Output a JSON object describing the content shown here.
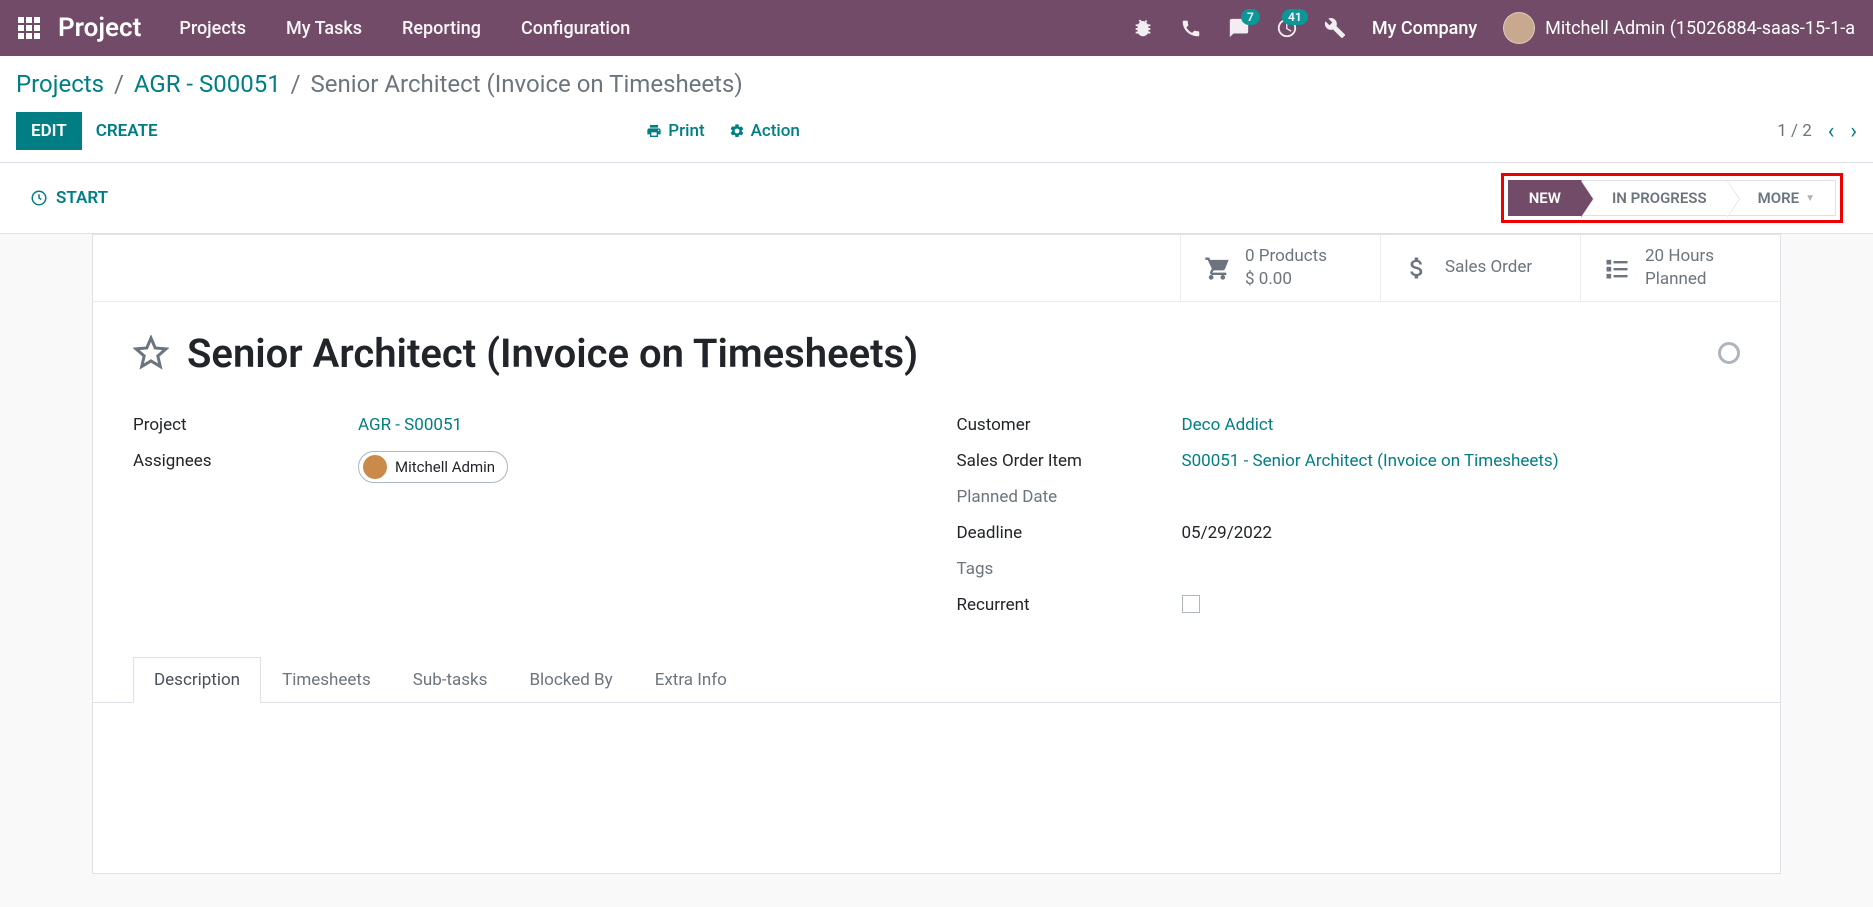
{
  "topnav": {
    "brand": "Project",
    "menu": [
      "Projects",
      "My Tasks",
      "Reporting",
      "Configuration"
    ],
    "msg_badge": "7",
    "activity_badge": "41",
    "company": "My Company",
    "user": "Mitchell Admin (15026884-saas-15-1-a"
  },
  "breadcrumbs": {
    "items": [
      "Projects",
      "AGR - S00051"
    ],
    "current": "Senior Architect (Invoice on Timesheets)"
  },
  "toolbar": {
    "edit": "EDIT",
    "create": "CREATE",
    "print": "Print",
    "action": "Action",
    "pager": "1 / 2"
  },
  "statusrow": {
    "start": "START",
    "stages": {
      "new": "NEW",
      "progress": "IN PROGRESS",
      "more": "MORE"
    }
  },
  "stats": {
    "products_line1": "0 Products",
    "products_line2": "$ 0.00",
    "sales_order": "Sales Order",
    "hours_line1": "20  Hours",
    "hours_line2": "Planned"
  },
  "task": {
    "title": "Senior Architect (Invoice on Timesheets)",
    "left": {
      "project_label": "Project",
      "project_value": "AGR - S00051",
      "assignees_label": "Assignees",
      "assignee_name": "Mitchell Admin"
    },
    "right": {
      "customer_label": "Customer",
      "customer_value": "Deco Addict",
      "soi_label": "Sales Order Item",
      "soi_value": "S00051 - Senior Architect (Invoice on Timesheets)",
      "planned_date_label": "Planned Date",
      "deadline_label": "Deadline",
      "deadline_value": "05/29/2022",
      "tags_label": "Tags",
      "recurrent_label": "Recurrent"
    }
  },
  "tabs": [
    "Description",
    "Timesheets",
    "Sub-tasks",
    "Blocked By",
    "Extra Info"
  ]
}
